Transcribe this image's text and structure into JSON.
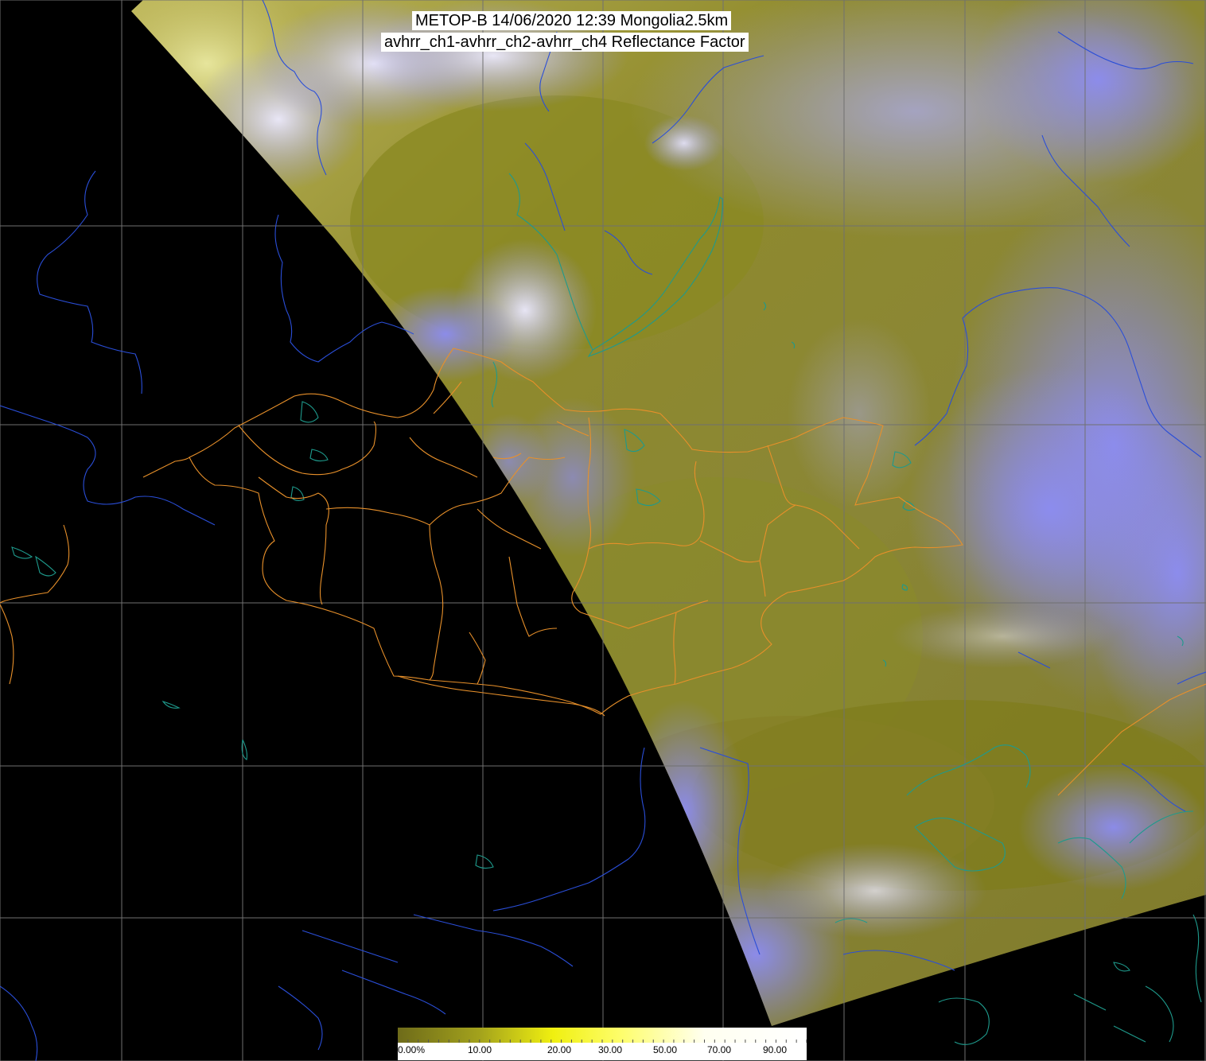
{
  "title": {
    "line1": "METOP-B 14/06/2020 12:39 Mongolia2.5km",
    "line2": "avhrr_ch1-avhrr_ch2-avhrr_ch4 Reflectance Factor"
  },
  "colorbar": {
    "labels": [
      "0.00%",
      "10.00",
      "20.00",
      "30.00",
      "50.00",
      "70.00",
      "90.00"
    ],
    "colors": [
      "#6e6b1a",
      "#a3a21c",
      "#f0f010",
      "#fefe6e",
      "#fffff0",
      "#ffffff"
    ]
  },
  "colors": {
    "background_night": "#000000",
    "surface_olive": "#8a8a2a",
    "cloud_lavender": "#8f8ff0",
    "cloud_white": "#e8e8ff",
    "gridline": "#707070",
    "admin_border": "#e8902a",
    "rivers_coast": "#2a4ed8",
    "lakes": "#1e9a8c"
  }
}
